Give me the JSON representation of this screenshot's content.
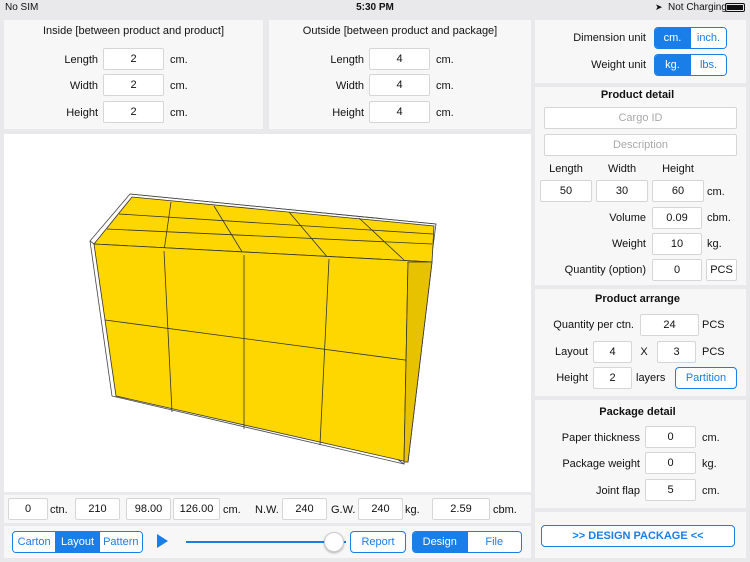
{
  "status_bar": {
    "carrier": "No SIM",
    "time": "5:30 PM",
    "battery": "Not Charging"
  },
  "inside": {
    "title": "Inside [between product and product]",
    "length_label": "Length",
    "length": "2",
    "width_label": "Width",
    "width": "2",
    "height_label": "Height",
    "height": "2",
    "unit": "cm."
  },
  "outside": {
    "title": "Outside [between product and package]",
    "length_label": "Length",
    "length": "4",
    "width_label": "Width",
    "width": "4",
    "height_label": "Height",
    "height": "4",
    "unit": "cm."
  },
  "units": {
    "dimension_label": "Dimension unit",
    "dimension_options": [
      "cm.",
      "inch."
    ],
    "weight_label": "Weight unit",
    "weight_options": [
      "kg.",
      "lbs."
    ]
  },
  "product_detail": {
    "title": "Product detail",
    "cargo_placeholder": "Cargo ID",
    "description_placeholder": "Description",
    "length_label": "Length",
    "width_label": "Width",
    "height_label": "Height",
    "length": "50",
    "width": "30",
    "height": "60",
    "dim_unit": "cm.",
    "volume_label": "Volume",
    "volume": "0.09",
    "volume_unit": "cbm.",
    "weight_label": "Weight",
    "weight": "10",
    "weight_unit": "kg.",
    "quantity_label": "Quantity (option)",
    "quantity": "0",
    "quantity_unit": "PCS"
  },
  "product_arrange": {
    "title": "Product arrange",
    "qty_label": "Quantity per ctn.",
    "qty": "24",
    "qty_unit": "PCS",
    "layout_label": "Layout",
    "layout_a": "4",
    "layout_x": "X",
    "layout_b": "3",
    "layout_unit": "PCS",
    "height_label": "Height",
    "height": "2",
    "height_unit": "layers",
    "partition_button": "Partition"
  },
  "package_detail": {
    "title": "Package detail",
    "paper_label": "Paper thickness",
    "paper": "0",
    "paper_unit": "cm.",
    "pkg_weight_label": "Package weight",
    "pkg_weight": "0",
    "pkg_weight_unit": "kg.",
    "flap_label": "Joint flap",
    "flap": "5",
    "flap_unit": "cm."
  },
  "summary": {
    "ctn": "0",
    "ctn_unit": "ctn.",
    "dim1": "210",
    "dim2": "98.00",
    "dim3": "126.00",
    "dim_unit": "cm.",
    "nw_label": "N.W.",
    "nw": "240",
    "gw_label": "G.W.",
    "gw": "240",
    "w_unit": "kg.",
    "cbm": "2.59",
    "cbm_unit": "cbm."
  },
  "bottom_bar": {
    "view_tabs": [
      "Carton",
      "Layout",
      "Pattern"
    ],
    "report_button": "Report",
    "mode_tabs": [
      "Design",
      "File"
    ],
    "design_package_button": ">> DESIGN PACKAGE <<"
  },
  "colors": {
    "accent": "#1a7ee8",
    "box_fill": "#ffd700"
  }
}
